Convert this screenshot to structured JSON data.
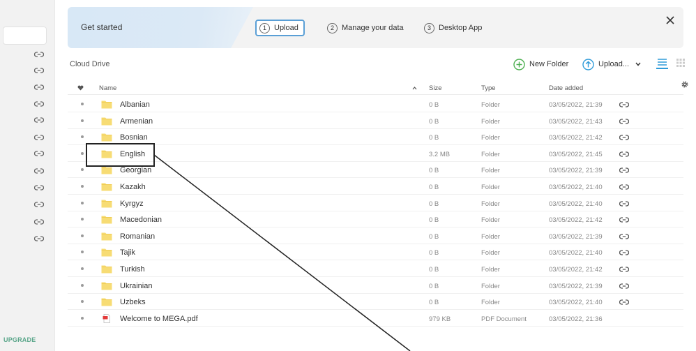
{
  "sidebar": {
    "link_rows": 12,
    "upgrade_label": "UPGRADE"
  },
  "banner": {
    "title": "Get started",
    "steps": [
      {
        "num": "1",
        "label": "Upload",
        "active": true
      },
      {
        "num": "2",
        "label": "Manage your data",
        "active": false
      },
      {
        "num": "3",
        "label": "Desktop App",
        "active": false
      }
    ],
    "close_icon": "close-icon"
  },
  "toolbar": {
    "breadcrumb": "Cloud Drive",
    "new_folder_label": "New Folder",
    "upload_label": "Upload...",
    "list_view_icon": "list-view-icon",
    "grid_view_icon": "grid-view-icon"
  },
  "table": {
    "headers": {
      "name": "Name",
      "size": "Size",
      "type": "Type",
      "date": "Date added"
    },
    "rows": [
      {
        "name": "Albanian",
        "size": "0 B",
        "type": "Folder",
        "date": "03/05/2022, 21:39",
        "kind": "folder",
        "linked": true
      },
      {
        "name": "Armenian",
        "size": "0 B",
        "type": "Folder",
        "date": "03/05/2022, 21:43",
        "kind": "folder",
        "linked": true
      },
      {
        "name": "Bosnian",
        "size": "0 B",
        "type": "Folder",
        "date": "03/05/2022, 21:42",
        "kind": "folder",
        "linked": true
      },
      {
        "name": "English",
        "size": "3.2 MB",
        "type": "Folder",
        "date": "03/05/2022, 21:45",
        "kind": "folder",
        "linked": true
      },
      {
        "name": "Georgian",
        "size": "0 B",
        "type": "Folder",
        "date": "03/05/2022, 21:39",
        "kind": "folder",
        "linked": true
      },
      {
        "name": "Kazakh",
        "size": "0 B",
        "type": "Folder",
        "date": "03/05/2022, 21:40",
        "kind": "folder",
        "linked": true
      },
      {
        "name": "Kyrgyz",
        "size": "0 B",
        "type": "Folder",
        "date": "03/05/2022, 21:40",
        "kind": "folder",
        "linked": true
      },
      {
        "name": "Macedonian",
        "size": "0 B",
        "type": "Folder",
        "date": "03/05/2022, 21:42",
        "kind": "folder",
        "linked": true
      },
      {
        "name": "Romanian",
        "size": "0 B",
        "type": "Folder",
        "date": "03/05/2022, 21:39",
        "kind": "folder",
        "linked": true
      },
      {
        "name": "Tajik",
        "size": "0 B",
        "type": "Folder",
        "date": "03/05/2022, 21:40",
        "kind": "folder",
        "linked": true
      },
      {
        "name": "Turkish",
        "size": "0 B",
        "type": "Folder",
        "date": "03/05/2022, 21:42",
        "kind": "folder",
        "linked": true
      },
      {
        "name": "Ukrainian",
        "size": "0 B",
        "type": "Folder",
        "date": "03/05/2022, 21:39",
        "kind": "folder",
        "linked": true
      },
      {
        "name": "Uzbeks",
        "size": "0 B",
        "type": "Folder",
        "date": "03/05/2022, 21:40",
        "kind": "folder",
        "linked": true
      },
      {
        "name": "Welcome to MEGA.pdf",
        "size": "979 KB",
        "type": "PDF Document",
        "date": "03/05/2022, 21:36",
        "kind": "pdf",
        "linked": false
      }
    ]
  },
  "colors": {
    "accent": "#2f9bd9",
    "new_folder_green": "#4caf50",
    "upgrade_green": "#5aa68a",
    "folder_yellow": "#f7dc74",
    "pdf_red": "#e33b3b"
  }
}
